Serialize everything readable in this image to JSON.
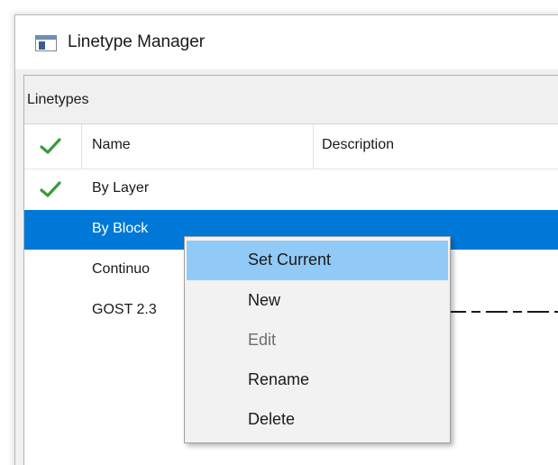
{
  "window": {
    "title": "Linetype Manager",
    "icon": "linetype-manager-app-icon"
  },
  "group": {
    "title": "Linetypes"
  },
  "list": {
    "columns": [
      {
        "label": "",
        "icon": "checkmark-icon"
      },
      {
        "label": "Name"
      },
      {
        "label": "Description"
      }
    ],
    "rows": [
      {
        "name": "By Layer",
        "current": true,
        "selected": false
      },
      {
        "name": "By Block",
        "current": false,
        "selected": true
      },
      {
        "name": "Continuo",
        "current": false,
        "selected": false
      },
      {
        "name": "GOST 2.3",
        "current": false,
        "selected": false,
        "pattern": "dash-dot"
      }
    ]
  },
  "context_menu": {
    "items": [
      {
        "label": "Set Current",
        "enabled": true,
        "highlighted": true
      },
      {
        "label": "New",
        "enabled": true,
        "highlighted": false
      },
      {
        "label": "Edit",
        "enabled": false,
        "highlighted": false
      },
      {
        "label": "Rename",
        "enabled": true,
        "highlighted": false
      },
      {
        "label": "Delete",
        "enabled": true,
        "highlighted": false
      }
    ]
  },
  "colors": {
    "selection": "#0078d7",
    "menu_highlight": "#91c9f7",
    "checkmark": "#3c9a3c",
    "disabled_text": "#6d6d6d"
  }
}
